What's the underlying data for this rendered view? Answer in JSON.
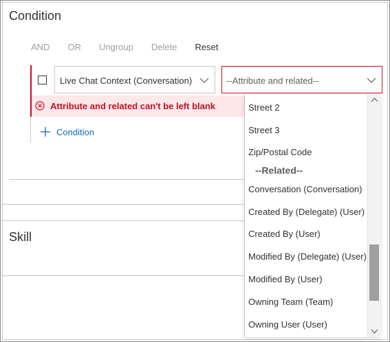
{
  "condition_section": {
    "title": "Condition"
  },
  "toolbar": {
    "and_label": "AND",
    "or_label": "OR",
    "ungroup_label": "Ungroup",
    "delete_label": "Delete",
    "reset_label": "Reset"
  },
  "row": {
    "context_select_value": "Live Chat Context (Conversation)",
    "attribute_select_value": "--Attribute and related--"
  },
  "error": {
    "message": "Attribute and related can't be left blank"
  },
  "add_condition": {
    "label": "Condition"
  },
  "skill_section": {
    "title": "Skill"
  },
  "dropdown": {
    "items": [
      "Street 2",
      "Street 3",
      "Zip/Postal Code",
      "--Related--",
      "Conversation (Conversation)",
      "Created By (Delegate) (User)",
      "Created By (User)",
      "Modified By (Delegate) (User)",
      "Modified By (User)",
      "Owning Team (Team)",
      "Owning User (User)"
    ],
    "scroll_position_fraction": 0.85
  },
  "icons": {
    "checkbox": "checkbox-icon",
    "chevron": "chevron-down-icon",
    "error": "error-circle-icon",
    "add": "plus-icon",
    "scroll_up": "scroll-up-arrow-icon",
    "scroll_down": "scroll-down-arrow-icon"
  },
  "colors": {
    "error_red": "#c50f1f",
    "error_bg": "#fde7e9",
    "link_blue": "#0f6cbd",
    "disabled_text": "#a19f9d"
  }
}
